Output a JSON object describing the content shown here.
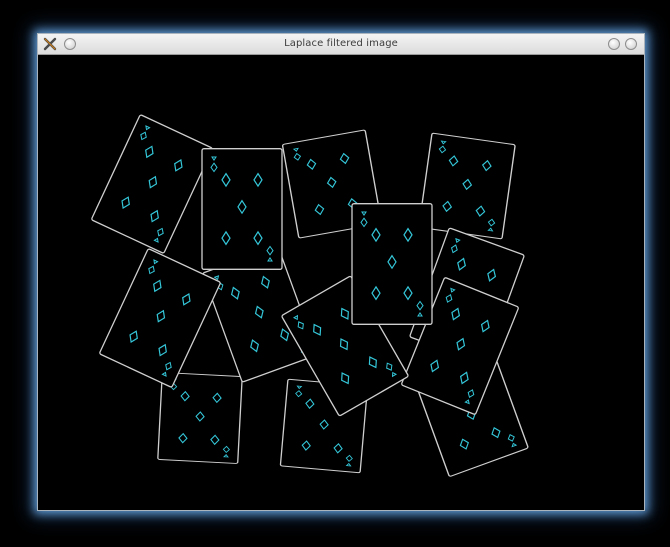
{
  "window": {
    "title": "Laplace filtered image"
  },
  "titlebar": {
    "app_icon": "x-app-icon",
    "left_button_icon": "menu-circle-icon",
    "right_buttons": [
      "minimize-circle-icon",
      "close-circle-icon"
    ]
  },
  "canvas": {
    "background": "#000000",
    "edge_color": "#cfcfcf",
    "pip_color": "#34c6d8",
    "card_suit": "diamonds"
  }
}
